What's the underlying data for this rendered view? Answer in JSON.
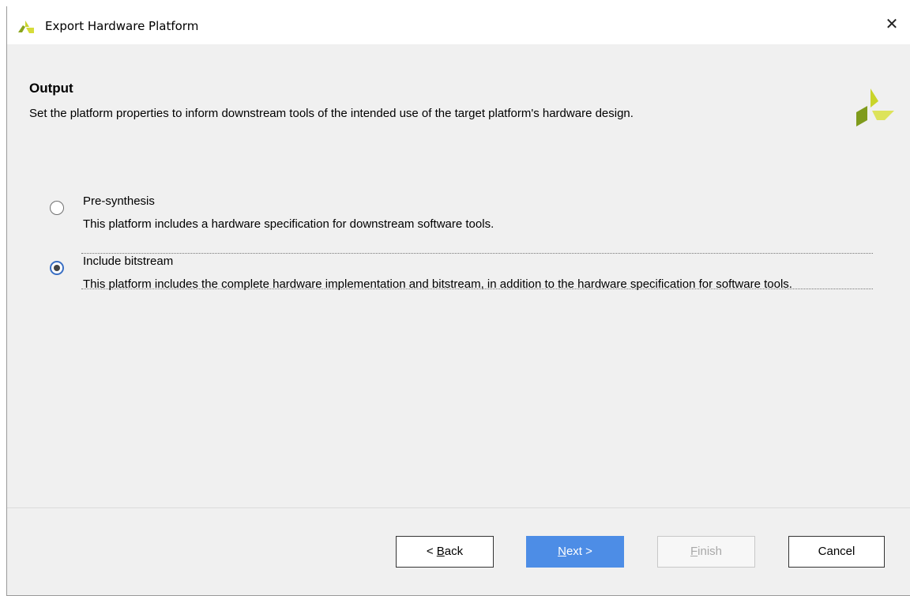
{
  "window": {
    "title": "Export Hardware Platform",
    "close_glyph": "✕",
    "logo_icon": "xilinx-logo-icon"
  },
  "header": {
    "title": "Output",
    "description": "Set the platform properties to inform downstream tools of the intended use of the target platform's hardware design.",
    "logo_icon": "xilinx-logo-icon"
  },
  "options": [
    {
      "label": "Pre-synthesis",
      "description": "This platform includes a hardware specification for downstream software tools.",
      "selected": false
    },
    {
      "label": "Include bitstream",
      "description": "This platform includes the complete hardware implementation and bitstream, in addition to the hardware specification for software tools.",
      "selected": true
    }
  ],
  "buttons": {
    "back": {
      "prefix": "< ",
      "mnemonic": "B",
      "rest": "ack"
    },
    "next": {
      "prefix": "",
      "mnemonic": "N",
      "rest": "ext >"
    },
    "finish": {
      "prefix": "",
      "mnemonic": "F",
      "rest": "inish",
      "enabled": false
    },
    "cancel": {
      "label": "Cancel"
    }
  },
  "colors": {
    "dialog_bg": "#f0f0f0",
    "primary_button": "#4d8de6",
    "logo_yellow": "#c9d42a",
    "logo_green": "#7a9a1a"
  }
}
